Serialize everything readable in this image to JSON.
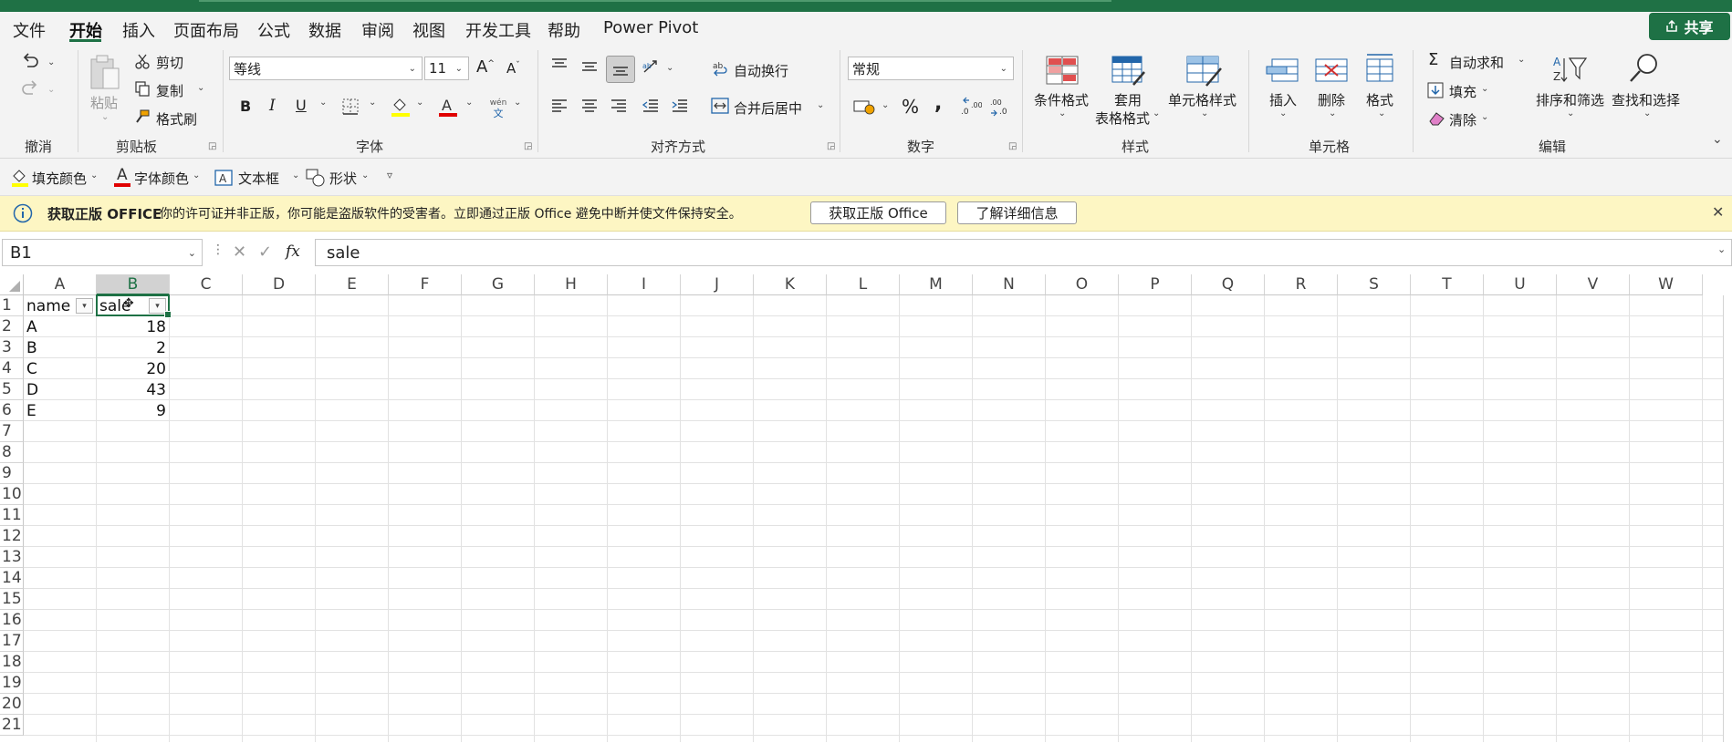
{
  "menubar": {
    "tabs": [
      "文件",
      "开始",
      "插入",
      "页面布局",
      "公式",
      "数据",
      "审阅",
      "视图",
      "开发工具",
      "帮助",
      "Power Pivot"
    ],
    "active_tab": "开始",
    "share_label": "共享"
  },
  "ribbon": {
    "undo": {
      "group_label": "撤消"
    },
    "clipboard": {
      "paste": "粘贴",
      "cut": "剪切",
      "copy": "复制",
      "format_painter": "格式刷",
      "group_label": "剪贴板"
    },
    "font": {
      "font_name": "等线",
      "font_size": "11",
      "grow": "A",
      "shrink": "A",
      "bold": "B",
      "italic": "I",
      "underline": "U",
      "pinyin_top": "wén",
      "pinyin_bottom": "文",
      "group_label": "字体"
    },
    "alignment": {
      "wrap_text": "自动换行",
      "merge_center": "合并后居中",
      "group_label": "对齐方式"
    },
    "number": {
      "format": "常规",
      "percent": "%",
      "comma": ",",
      "inc_decimal": ".0 .00",
      "dec_decimal": ".00 .0",
      "group_label": "数字"
    },
    "styles": {
      "conditional": "条件格式",
      "table_format_1": "套用",
      "table_format_2": "表格格式",
      "cell_styles": "单元格样式",
      "group_label": "样式"
    },
    "cells": {
      "insert": "插入",
      "delete": "删除",
      "format": "格式",
      "group_label": "单元格"
    },
    "editing": {
      "autosum": "自动求和",
      "fill": "填充",
      "clear": "清除",
      "sort_filter": "排序和筛选",
      "find_select": "查找和选择",
      "group_label": "编辑"
    }
  },
  "quick_access": {
    "fill_color": "填充颜色",
    "font_color": "字体颜色",
    "font_color_glyph": "A",
    "text_box": "文本框",
    "shapes": "形状"
  },
  "message_bar": {
    "title": "获取正版 OFFICE",
    "text": "你的许可证并非正版，你可能是盗版软件的受害者。立即通过正版 Office 避免中断并使文件保持安全。",
    "button_get": "获取正版 Office",
    "button_learn": "了解详细信息"
  },
  "formula_bar": {
    "name_box": "B1",
    "fx": "fx",
    "content": "sale"
  },
  "sheet": {
    "columns": [
      "A",
      "B",
      "C",
      "D",
      "E",
      "F",
      "G",
      "H",
      "I",
      "J",
      "K",
      "L",
      "M",
      "N",
      "O",
      "P",
      "Q",
      "R",
      "S",
      "T",
      "U",
      "V",
      "W"
    ],
    "selected_column": "B",
    "rows": [
      "1",
      "2",
      "3",
      "4",
      "5",
      "6",
      "7",
      "8",
      "9",
      "10",
      "11",
      "12",
      "13",
      "14",
      "15",
      "16",
      "17",
      "18",
      "19",
      "20",
      "21"
    ],
    "headers": [
      "name",
      "sale"
    ],
    "data": [
      [
        "A",
        "18"
      ],
      [
        "B",
        "2"
      ],
      [
        "C",
        "20"
      ],
      [
        "D",
        "43"
      ],
      [
        "E",
        "9"
      ]
    ]
  },
  "colors": {
    "accent": "#1e7145",
    "ribbon_bg": "#f3f3f3",
    "message_bg": "#fdf6c3"
  }
}
